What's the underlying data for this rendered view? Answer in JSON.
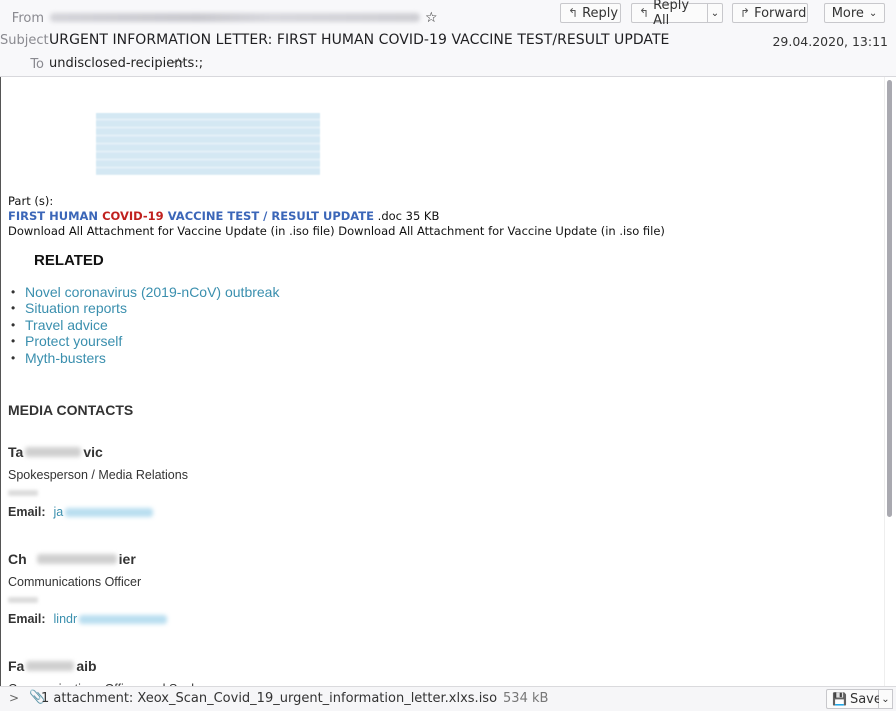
{
  "header": {
    "from_label": "From",
    "subject_label": "Subject",
    "to_label": "To",
    "subject": "URGENT INFORMATION LETTER: FIRST HUMAN COVID-19 VACCINE TEST/RESULT UPDATE",
    "to": "undisclosed-recipients:;",
    "date": "29.04.2020, 13:11",
    "buttons": {
      "reply": "Reply",
      "reply_all": "Reply All",
      "forward": "Forward",
      "more": "More"
    },
    "icons": {
      "reply": "↰",
      "reply_all": "↰",
      "forward": "↱",
      "dropdown": "⌄",
      "star": "☆"
    }
  },
  "body": {
    "parts_label": "Part (s):",
    "attachment_title": {
      "part1": "FIRST HUMAN ",
      "part2": "COVID-19",
      "part3": " VACCINE TEST / RESULT UPDATE",
      "suffix": " .doc 35 KB"
    },
    "download_line": "Download All Attachment for Vaccine Update (in .iso file) Download All Attachment for Vaccine Update (in .iso file)",
    "related_heading": "RELATED",
    "related_links": [
      "Novel coronavirus (2019-nCoV) outbreak",
      "Situation reports",
      "Travel advice",
      "Protect yourself",
      "Myth-busters"
    ],
    "media_heading": "MEDIA CONTACTS",
    "contacts": [
      {
        "name_start": "Ta",
        "name_end": "vic",
        "role": "Spokesperson / Media Relations",
        "email_label": "Email:",
        "email_start": "ja"
      },
      {
        "name_start": "Ch",
        "name_end": "ier",
        "role": "Communications Officer",
        "email_label": "Email:",
        "email_start": "lindr"
      },
      {
        "name_start": "Fa",
        "name_end": "aib",
        "role": "Communications Officer and Spokesperson"
      }
    ]
  },
  "footer": {
    "attachment_text": "1 attachment: Xeox_Scan_Covid_19_urgent_information_letter.xlxs.iso",
    "attachment_size": "534 kB",
    "save_label": "Save"
  },
  "colors": {
    "link": "#3a8fae",
    "title_blue": "#3b66b8",
    "title_red": "#c0211f"
  }
}
